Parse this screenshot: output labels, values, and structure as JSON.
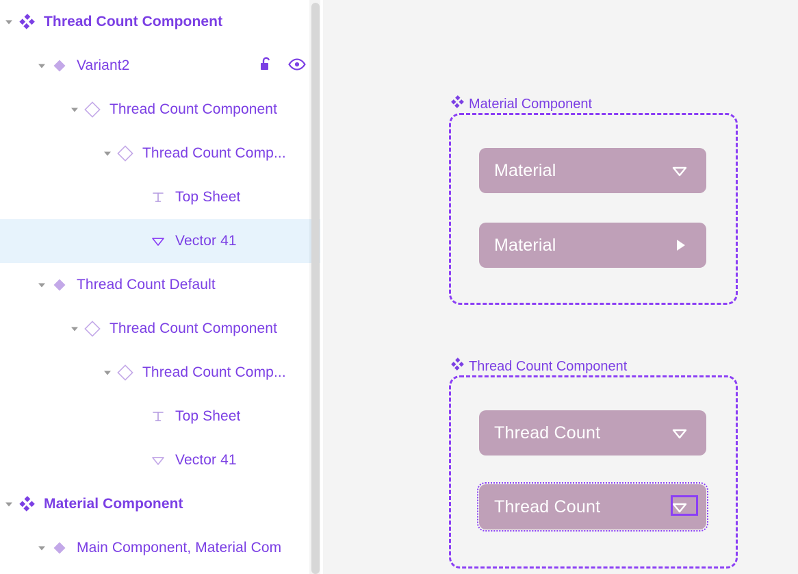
{
  "layers_panel": {
    "name": "layers-panel",
    "rows": [
      {
        "label": "Thread Count Component",
        "icon": "component-set-icon",
        "indent": 0,
        "bold": true,
        "caret": "expanded",
        "selected": false,
        "actions": []
      },
      {
        "label": "Variant2",
        "icon": "variant-diamond-icon",
        "indent": 1,
        "bold": false,
        "caret": "expanded",
        "selected": false,
        "actions": [
          "unlock-icon",
          "eye-icon"
        ]
      },
      {
        "label": "Thread Count Component",
        "icon": "instance-diamond-icon",
        "indent": 2,
        "bold": false,
        "caret": "expanded",
        "selected": false,
        "actions": []
      },
      {
        "label": "Thread Count Comp...",
        "icon": "instance-diamond-icon",
        "indent": 3,
        "bold": false,
        "caret": "expanded",
        "selected": false,
        "actions": []
      },
      {
        "label": "Top Sheet",
        "icon": "text-icon",
        "indent": 4,
        "bold": false,
        "caret": "none",
        "selected": false,
        "actions": []
      },
      {
        "label": "Vector 41",
        "icon": "vector-triangle-icon",
        "indent": 4,
        "bold": false,
        "caret": "none",
        "selected": true,
        "actions": []
      },
      {
        "label": "Thread Count Default",
        "icon": "variant-diamond-icon",
        "indent": 1,
        "bold": false,
        "caret": "expanded",
        "selected": false,
        "actions": []
      },
      {
        "label": "Thread Count Component",
        "icon": "instance-diamond-icon",
        "indent": 2,
        "bold": false,
        "caret": "expanded",
        "selected": false,
        "actions": []
      },
      {
        "label": "Thread Count Comp...",
        "icon": "instance-diamond-icon",
        "indent": 3,
        "bold": false,
        "caret": "expanded",
        "selected": false,
        "actions": []
      },
      {
        "label": "Top Sheet",
        "icon": "text-icon",
        "indent": 4,
        "bold": false,
        "caret": "none",
        "selected": false,
        "actions": []
      },
      {
        "label": "Vector 41",
        "icon": "vector-triangle-icon",
        "indent": 4,
        "bold": false,
        "caret": "none",
        "selected": false,
        "actions": []
      },
      {
        "label": "Material Component",
        "icon": "component-set-icon",
        "indent": 0,
        "bold": true,
        "caret": "expanded",
        "selected": false,
        "actions": []
      },
      {
        "label": "Main Component, Material Com",
        "icon": "variant-diamond-icon",
        "indent": 1,
        "bold": false,
        "caret": "expanded",
        "selected": false,
        "actions": []
      }
    ]
  },
  "canvas": {
    "frames": [
      {
        "title": "Material Component",
        "title_icon": "component-set-icon",
        "buttons": [
          {
            "label": "Material",
            "icon": "chevron-down-outline-icon",
            "selected": false,
            "icon_selected": false
          },
          {
            "label": "Material",
            "icon": "play-triangle-icon",
            "selected": false,
            "icon_selected": false
          }
        ]
      },
      {
        "title": "Thread Count Component",
        "title_icon": "component-set-icon",
        "buttons": [
          {
            "label": "Thread Count",
            "icon": "chevron-down-outline-icon",
            "selected": false,
            "icon_selected": false
          },
          {
            "label": "Thread Count",
            "icon": "chevron-down-outline-icon",
            "selected": true,
            "icon_selected": true
          }
        ]
      }
    ]
  },
  "colors": {
    "accent_purple": "#7b3fe4",
    "frame_stroke": "#8b3ff5",
    "button_fill": "#bfa0b8",
    "selected_row": "#e7f3fc",
    "canvas_bg": "#f4f4f4",
    "panel_bg": "#ffffff",
    "scrollbar": "#d7d7d7"
  }
}
